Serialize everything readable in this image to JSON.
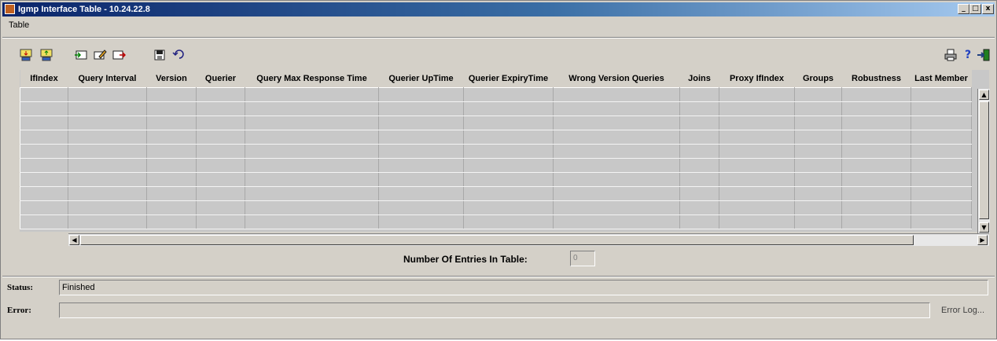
{
  "window": {
    "title": "Igmp Interface Table - 10.24.22.8",
    "controls": [
      "_",
      "□",
      "x"
    ]
  },
  "menu": {
    "items": [
      "Table"
    ]
  },
  "toolbar": {
    "left_icons": [
      "import-icon",
      "export-icon",
      "insert-row-icon",
      "edit-row-icon",
      "delete-row-icon",
      "save-icon",
      "undo-icon"
    ],
    "right_icons": [
      "print-icon",
      "help-icon",
      "exit-icon"
    ],
    "help_glyph": "?"
  },
  "table": {
    "columns": [
      "IfIndex",
      "Query Interval",
      "Version",
      "Querier",
      "Query Max Response Time",
      "Querier UpTime",
      "Querier ExpiryTime",
      "Wrong Version Queries",
      "Joins",
      "Proxy IfIndex",
      "Groups",
      "Robustness",
      "Last Member"
    ],
    "rows": [
      [
        "",
        "",
        "",
        "",
        "",
        "",
        "",
        "",
        "",
        "",
        "",
        "",
        ""
      ],
      [
        "",
        "",
        "",
        "",
        "",
        "",
        "",
        "",
        "",
        "",
        "",
        "",
        ""
      ],
      [
        "",
        "",
        "",
        "",
        "",
        "",
        "",
        "",
        "",
        "",
        "",
        "",
        ""
      ],
      [
        "",
        "",
        "",
        "",
        "",
        "",
        "",
        "",
        "",
        "",
        "",
        "",
        ""
      ],
      [
        "",
        "",
        "",
        "",
        "",
        "",
        "",
        "",
        "",
        "",
        "",
        "",
        ""
      ],
      [
        "",
        "",
        "",
        "",
        "",
        "",
        "",
        "",
        "",
        "",
        "",
        "",
        ""
      ],
      [
        "",
        "",
        "",
        "",
        "",
        "",
        "",
        "",
        "",
        "",
        "",
        "",
        ""
      ],
      [
        "",
        "",
        "",
        "",
        "",
        "",
        "",
        "",
        "",
        "",
        "",
        "",
        ""
      ],
      [
        "",
        "",
        "",
        "",
        "",
        "",
        "",
        "",
        "",
        "",
        "",
        "",
        ""
      ],
      [
        "",
        "",
        "",
        "",
        "",
        "",
        "",
        "",
        "",
        "",
        "",
        "",
        ""
      ]
    ]
  },
  "entries": {
    "label": "Number Of Entries In Table:",
    "value": "0"
  },
  "status": {
    "label": "Status:",
    "value": "Finished"
  },
  "error": {
    "label": "Error:",
    "value": "",
    "log_label": "Error Log..."
  }
}
